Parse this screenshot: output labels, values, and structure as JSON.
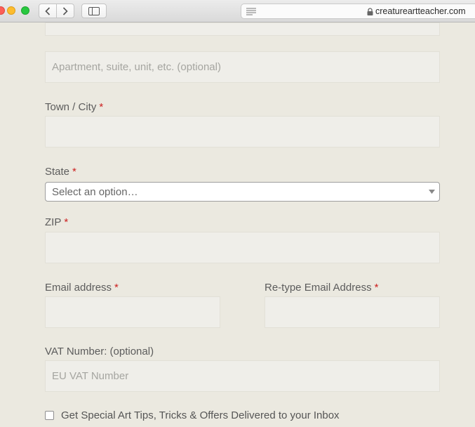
{
  "browser": {
    "url": "creatureartteacher.com"
  },
  "form": {
    "apartment": {
      "placeholder": "Apartment, suite, unit, etc. (optional)",
      "value": ""
    },
    "city": {
      "label": "Town / City",
      "required": "*",
      "value": ""
    },
    "state": {
      "label": "State",
      "required": "*",
      "selected": "Select an option…"
    },
    "zip": {
      "label": "ZIP",
      "required": "*",
      "value": ""
    },
    "email": {
      "label": "Email address",
      "required": "*",
      "value": ""
    },
    "email_confirm": {
      "label": "Re-type Email Address",
      "required": "*",
      "value": ""
    },
    "vat": {
      "label": "VAT Number: (optional)",
      "placeholder": "EU VAT Number",
      "value": ""
    },
    "newsletter": {
      "label": "Get Special Art Tips, Tricks & Offers Delivered to your Inbox",
      "checked": false
    }
  },
  "colors": {
    "background": "#ebe9e0",
    "field_background": "#efeee9",
    "required_star": "#cc2020",
    "text": "#5c5c5c"
  }
}
